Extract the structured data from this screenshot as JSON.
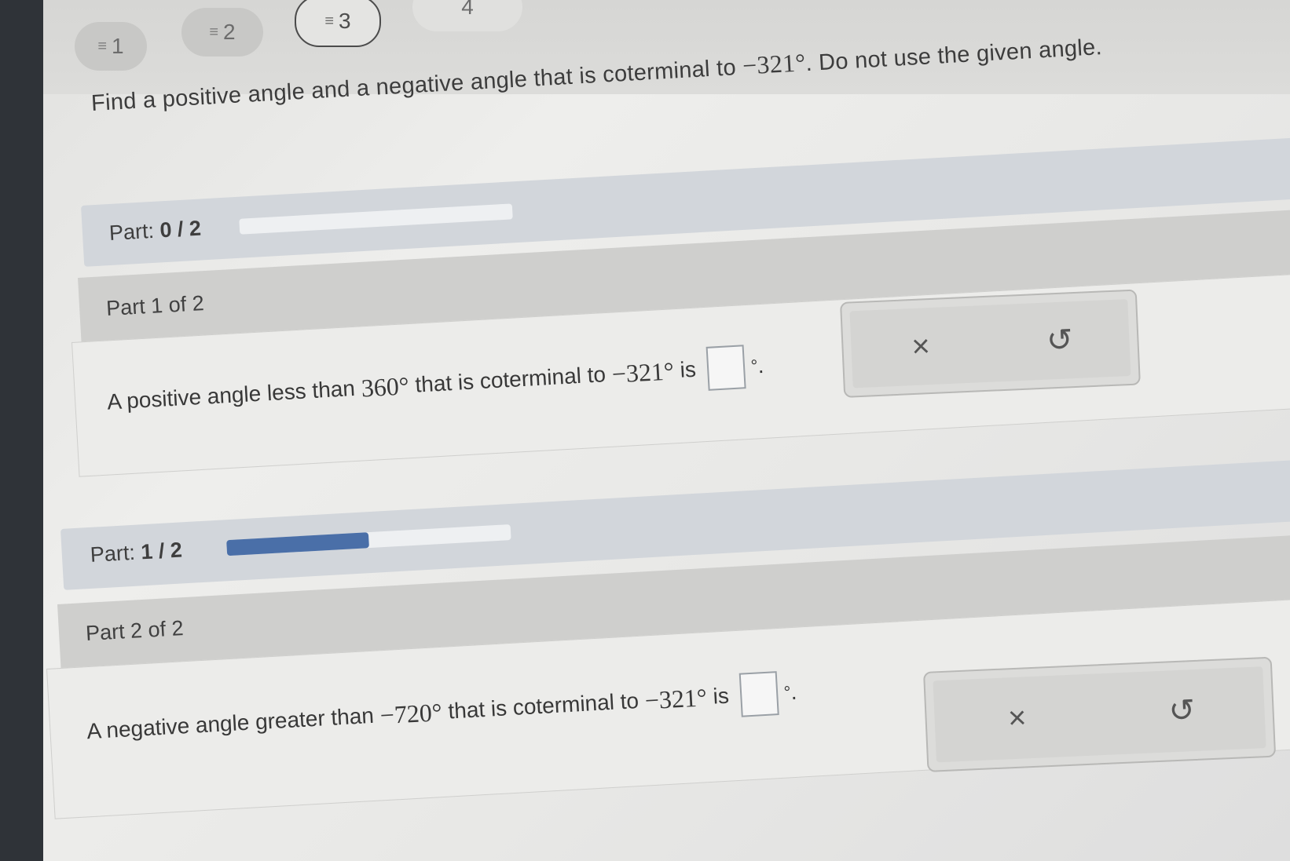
{
  "tabs": [
    {
      "marker": "≡",
      "label": "1",
      "state": "answered"
    },
    {
      "marker": "≡",
      "label": "2",
      "state": "answered"
    },
    {
      "marker": "≡",
      "label": "3",
      "state": "current"
    },
    {
      "marker": "",
      "label": "4",
      "state": "unanswered"
    }
  ],
  "question": {
    "prefix": "Find a positive angle and a negative angle that is coterminal to ",
    "angle": "−321°",
    "suffix": ". Do not use the given angle."
  },
  "part_progress_1": {
    "label": "Part: ",
    "value": "0 / 2",
    "fraction": 0.0
  },
  "part1": {
    "header": "Part 1 of 2",
    "prompt_prefix": "A positive angle less than ",
    "bound": "360°",
    "prompt_mid": " that is coterminal to ",
    "angle": "−321°",
    "prompt_is": " is",
    "answer_value": "",
    "degree_symbol": "°",
    "period": "."
  },
  "part_progress_2": {
    "label": "Part: ",
    "value": "1 / 2",
    "fraction": 0.5
  },
  "part2": {
    "header": "Part 2 of 2",
    "prompt_prefix": "A negative angle greater than ",
    "bound": "−720°",
    "prompt_mid": " that is coterminal to ",
    "angle": "−321°",
    "prompt_is": " is",
    "answer_value": "",
    "degree_symbol": "°",
    "period": "."
  },
  "tools": {
    "clear_symbol": "×",
    "undo_symbol": "↺"
  },
  "colors": {
    "progress_fill": "#4a6fa8",
    "part_bar": "#d2d6db",
    "part_header": "#cfcfcd"
  }
}
